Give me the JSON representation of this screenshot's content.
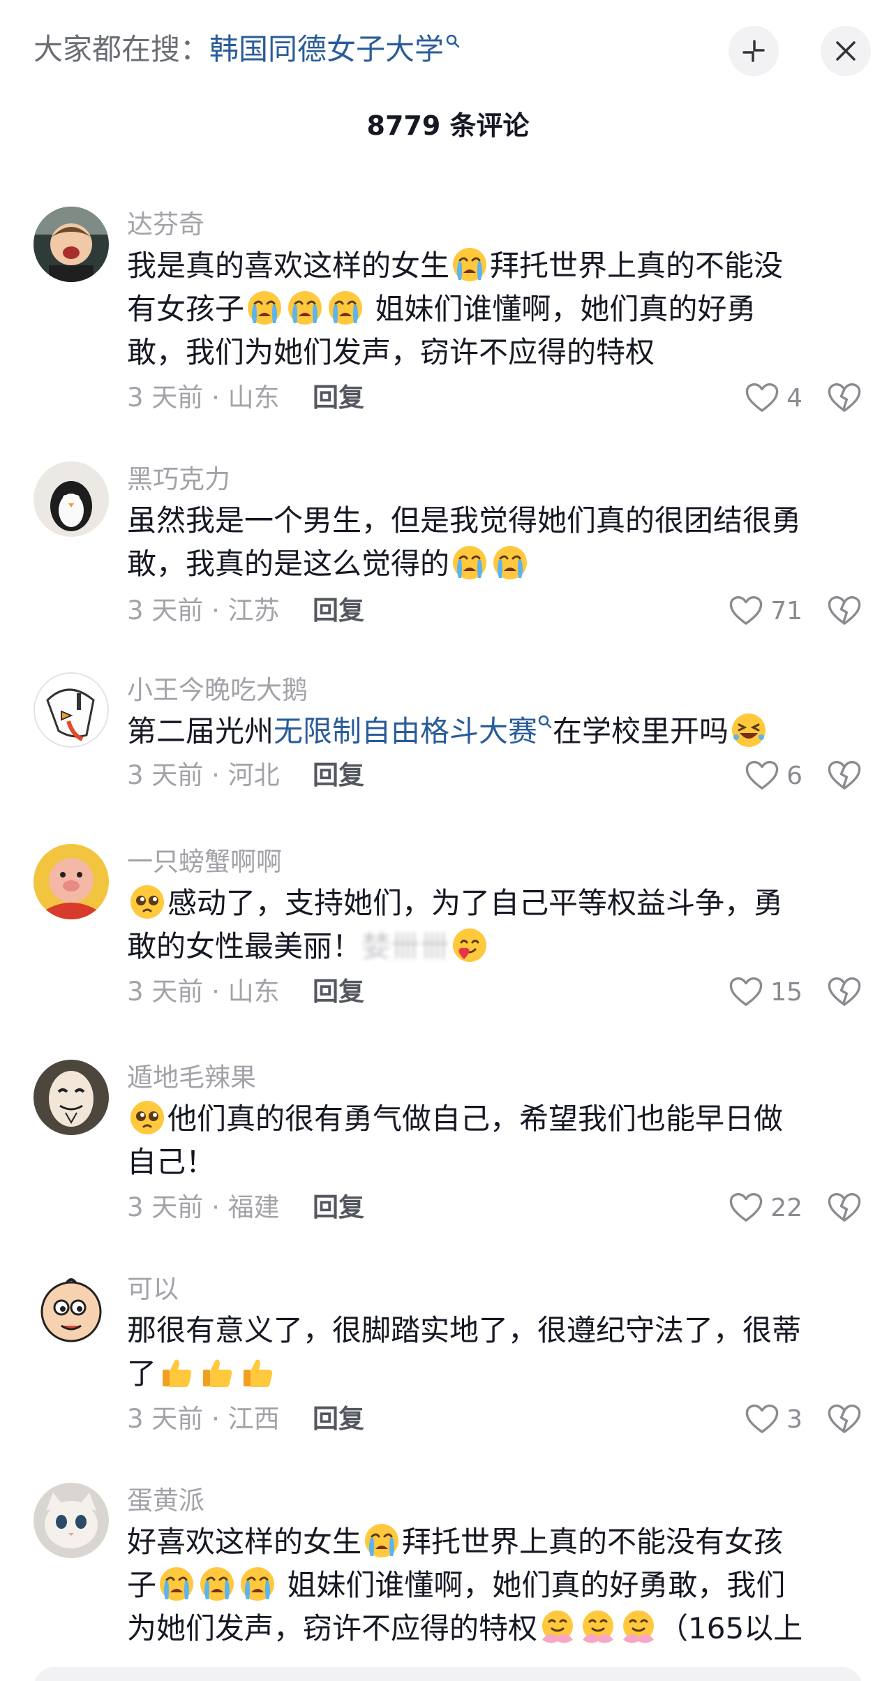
{
  "header": {
    "hot_prefix": "大家都在搜：",
    "hot_keyword": "韩国同德女子大学",
    "comment_count": "8779 条评论"
  },
  "comments": [
    {
      "username": "达芬奇",
      "lines": [
        "我是真的喜欢这样的女生",
        "拜托世界上真的不能没",
        "有女孩子",
        " 姐妹们谁懂啊，她们真的好勇",
        "敢，我们为她们发声，窃许不应得的特权"
      ],
      "meta": "3 天前 · 山东",
      "reply": "回复",
      "likes": "4"
    },
    {
      "username": "黑巧克力",
      "lines": [
        "虽然我是一个男生，但是我觉得她们真的很团结很勇",
        "敢，我真的是这么觉得的"
      ],
      "meta": "3 天前 · 江苏",
      "reply": "回复",
      "likes": "71"
    },
    {
      "username": "小王今晚吃大鹅",
      "lines": [
        "第二届光州",
        "无限制自由格斗大赛",
        "在学校里开吗"
      ],
      "meta": "3 天前 · 河北",
      "reply": "回复",
      "likes": "6"
    },
    {
      "username": "一只螃蟹啊啊",
      "lines": [
        "感动了，支持她们，为了自己平等权益斗争，勇",
        "敢的女性最美丽！",
        "婪卌卌"
      ],
      "meta": "3 天前 · 山东",
      "reply": "回复",
      "likes": "15"
    },
    {
      "username": "遁地毛辣果",
      "lines": [
        "他们真的很有勇气做自己，希望我们也能早日做",
        "自己！"
      ],
      "meta": "3 天前 · 福建",
      "reply": "回复",
      "likes": "22"
    },
    {
      "username": "可以",
      "lines": [
        "那很有意义了，很脚踏实地了，很遵纪守法了，很蒂",
        "了"
      ],
      "meta": "3 天前 · 江西",
      "reply": "回复",
      "likes": "3"
    },
    {
      "username": "蛋黄派",
      "lines": [
        "好喜欢这样的女生",
        "拜托世界上真的不能没有女孩",
        "子",
        " 姐妹们谁懂啊，她们真的好勇敢，我们",
        "为她们发声，窃许不应得的特权",
        "（165以上"
      ]
    }
  ],
  "icons": {
    "crying": "loudly-crying-face",
    "laughing": "rolling-laughing-face",
    "pleading": "pleading-face",
    "heart_face": "smiling-face-with-hearts",
    "thumbs_up": "thumbs-up",
    "hug": "hugging-face",
    "like": "heart-outline-icon",
    "dislike": "broken-heart-icon"
  },
  "colors": {
    "keyword_blue": "#2a5c9a",
    "secondary_text": "#a2a3a8",
    "primary_text": "#161823"
  }
}
